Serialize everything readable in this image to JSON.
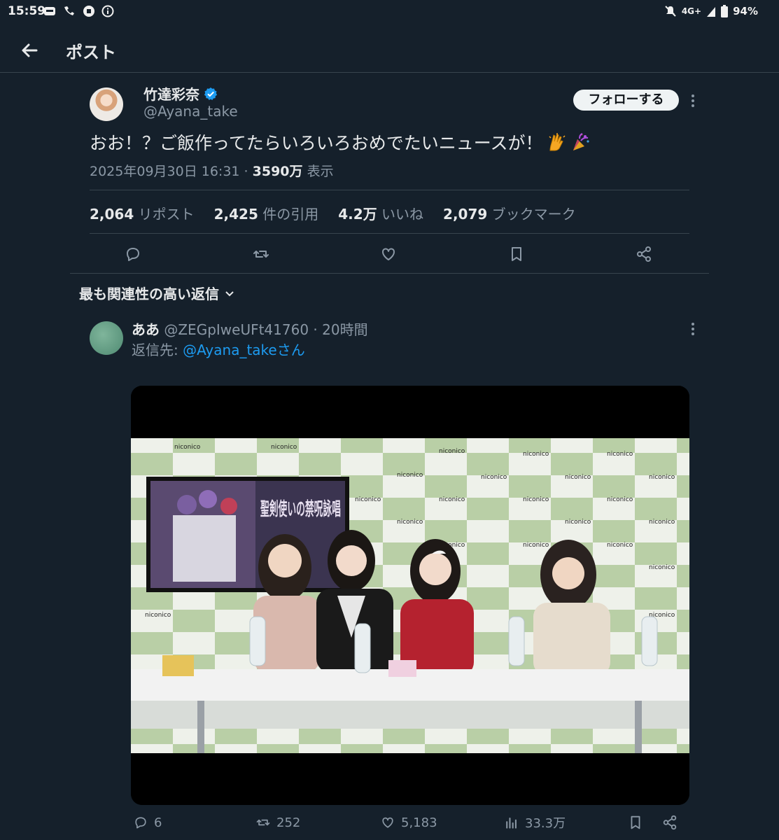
{
  "status_bar": {
    "time": "15:59",
    "network": "4G+",
    "battery": "94%"
  },
  "header": {
    "title": "ポスト"
  },
  "post": {
    "author_name": "竹達彩奈",
    "author_handle": "@Ayana_take",
    "follow_label": "フォローする",
    "text": "おお！？ご飯作ってたらいろいろおめでたいニュースが！",
    "emojis": [
      "raising-hands-emoji",
      "party-popper-emoji"
    ],
    "timestamp": "2025年09月30日 16:31",
    "meta_sep": " · ",
    "views_count": "3590万",
    "views_label": "表示",
    "stats": {
      "reposts_count": "2,064",
      "reposts_label": "リポスト",
      "quotes_count": "2,425",
      "quotes_label": "件の引用",
      "likes_count": "4.2万",
      "likes_label": "いいね",
      "bookmarks_count": "2,079",
      "bookmarks_label": "ブックマーク"
    }
  },
  "replies_sort": {
    "label": "最も関連性の高い返信"
  },
  "reply": {
    "author_name": "ああ",
    "author_handle": "@ZEGpIweUFt41760",
    "time_sep": " · ",
    "time": "20時間",
    "reply_to_label": "返信先: ",
    "reply_to_link": "@Ayana_takeさん",
    "media": {
      "banner_text": "聖剣使いの禁呪詠唱",
      "logo_text": "niconico"
    },
    "counts": {
      "replies": "6",
      "reposts": "252",
      "likes": "5,183",
      "views": "33.3万"
    }
  },
  "colors": {
    "background": "#15202b",
    "text": "#e7e9ea",
    "secondary": "#8b98a5",
    "accent": "#1d9bf0",
    "divider": "#38444d"
  }
}
